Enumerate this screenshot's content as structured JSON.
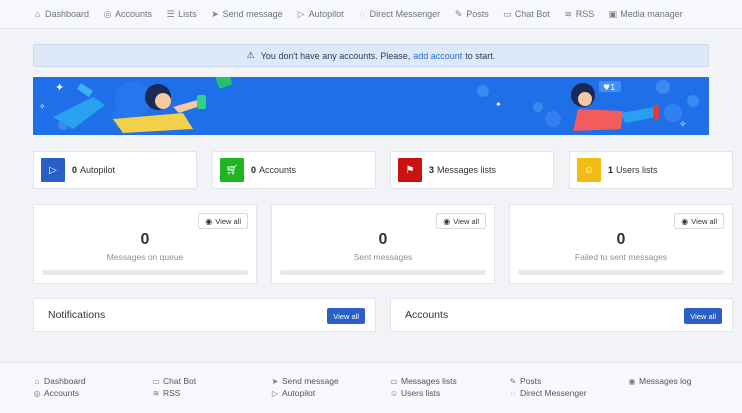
{
  "nav": [
    {
      "label": "Dashboard",
      "icon": "home-icon"
    },
    {
      "label": "Accounts",
      "icon": "account-icon"
    },
    {
      "label": "Lists",
      "icon": "list-icon"
    },
    {
      "label": "Send message",
      "icon": "send-icon"
    },
    {
      "label": "Autopilot",
      "icon": "play-icon"
    },
    {
      "label": "Direct Messenger",
      "icon": "messenger-icon"
    },
    {
      "label": "Posts",
      "icon": "pencil-icon"
    },
    {
      "label": "Chat Bot",
      "icon": "chat-icon"
    },
    {
      "label": "RSS",
      "icon": "rss-icon"
    },
    {
      "label": "Media manager",
      "icon": "image-icon"
    }
  ],
  "alert": {
    "prefix": "You don't have any accounts. Please,",
    "link": "add account",
    "suffix": "to start."
  },
  "stats": [
    {
      "value": "0",
      "label": "Autopilot",
      "color": "#2a5fc7",
      "icon": "play-icon"
    },
    {
      "value": "0",
      "label": "Accounts",
      "color": "#1fb51f",
      "icon": "cart-icon"
    },
    {
      "value": "3",
      "label": "Messages lists",
      "color": "#cc1111",
      "icon": "flag-icon"
    },
    {
      "value": "1",
      "label": "Users lists",
      "color": "#f2bd12",
      "icon": "users-icon"
    }
  ],
  "cards": [
    {
      "value": "0",
      "caption": "Messages on queue",
      "button": "View all"
    },
    {
      "value": "0",
      "caption": "Sent messages",
      "button": "View all"
    },
    {
      "value": "0",
      "caption": "Failed to sent messages",
      "button": "View all"
    }
  ],
  "panels": [
    {
      "title": "Notifications",
      "button": "View all"
    },
    {
      "title": "Accounts",
      "button": "View all"
    }
  ],
  "footer": [
    {
      "label": "Dashboard",
      "icon": "home-icon"
    },
    {
      "label": "Accounts",
      "icon": "account-icon"
    },
    {
      "label": "Chat Bot",
      "icon": "chat-icon"
    },
    {
      "label": "RSS",
      "icon": "rss-icon"
    },
    {
      "label": "Send message",
      "icon": "send-icon"
    },
    {
      "label": "Autopilot",
      "icon": "play-icon"
    },
    {
      "label": "Messages lists",
      "icon": "messages-icon"
    },
    {
      "label": "Users lists",
      "icon": "users-icon"
    },
    {
      "label": "Posts",
      "icon": "pencil-icon"
    },
    {
      "label": "Direct Messenger",
      "icon": "messenger-icon"
    },
    {
      "label": "Messages log",
      "icon": "eye-icon"
    }
  ]
}
